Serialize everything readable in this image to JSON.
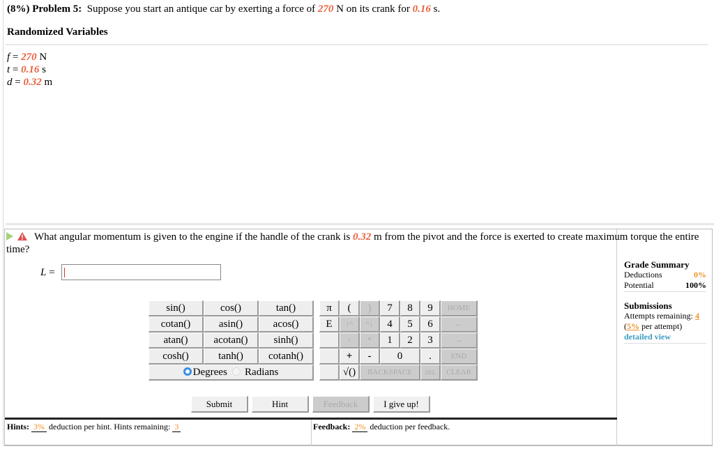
{
  "problem": {
    "weight": "(8%)",
    "label": "Problem 5:",
    "text_before": "Suppose you start an antique car by exerting a force of",
    "force_value": "270",
    "text_mid": "N on its crank for",
    "time_value": "0.16",
    "text_after": "s."
  },
  "randomized": {
    "title": "Randomized Variables",
    "vars": [
      {
        "symbol": "f",
        "eq": " = ",
        "value": "270",
        "unit": " N"
      },
      {
        "symbol": "t",
        "eq": " = ",
        "value": "0.16",
        "unit": " s"
      },
      {
        "symbol": "d",
        "eq": " = ",
        "value": "0.32",
        "unit": " m"
      }
    ]
  },
  "question": {
    "text_before": "What angular momentum is given to the engine if the handle of the crank is",
    "distance_value": "0.32",
    "text_after": "m from the pivot and the force is exerted to create maximum torque the entire time?",
    "answer_label": "L",
    "answer_eq": " = ",
    "answer_value": "",
    "answer_placeholder": ""
  },
  "keypad": {
    "functions": [
      [
        "sin()",
        "cos()",
        "tan()"
      ],
      [
        "cotan()",
        "asin()",
        "acos()"
      ],
      [
        "atan()",
        "acotan()",
        "sinh()"
      ],
      [
        "cosh()",
        "tanh()",
        "cotanh()"
      ]
    ],
    "degrees_label": "Degrees",
    "radians_label": "Radians",
    "selected_mode": "Degrees",
    "pi": "π",
    "e": "E",
    "open_paren": "(",
    "close_paren": ")",
    "up_caret": "↑^",
    "caret_down": "^↓",
    "divide": "/",
    "multiply": "*",
    "plus": "+",
    "minus": "-",
    "sqrt": "√()",
    "digits": [
      "7",
      "8",
      "9",
      "4",
      "5",
      "6",
      "1",
      "2",
      "3",
      "0",
      "."
    ],
    "home": "HOME",
    "left": "←",
    "right": "→",
    "end": "END",
    "backspace": "BACKSPACE",
    "del": "DEL",
    "clear": "CLEAR"
  },
  "grade_summary": {
    "title": "Grade Summary",
    "deductions_label": "Deductions",
    "deductions_value": "0%",
    "potential_label": "Potential",
    "potential_value": "100%"
  },
  "submissions": {
    "title": "Submissions",
    "attempts_label": "Attempts remaining:",
    "attempts_value": "4",
    "per_attempt_open": "(",
    "per_attempt_value": "5%",
    "per_attempt_text": " per attempt)",
    "detailed_view": "detailed view"
  },
  "buttons": {
    "submit": "Submit",
    "hint": "Hint",
    "feedback": "Feedback",
    "give_up": "I give up!"
  },
  "hints": {
    "label": "Hints:",
    "pct": "3%",
    "text": "deduction per hint. Hints remaining:",
    "remaining": "3"
  },
  "feedback": {
    "label": "Feedback:",
    "pct": "2%",
    "text": "deduction per feedback."
  },
  "colors": {
    "variable": "#e8603c",
    "accent_orange": "#f0922b",
    "link": "#3c9dbf"
  }
}
